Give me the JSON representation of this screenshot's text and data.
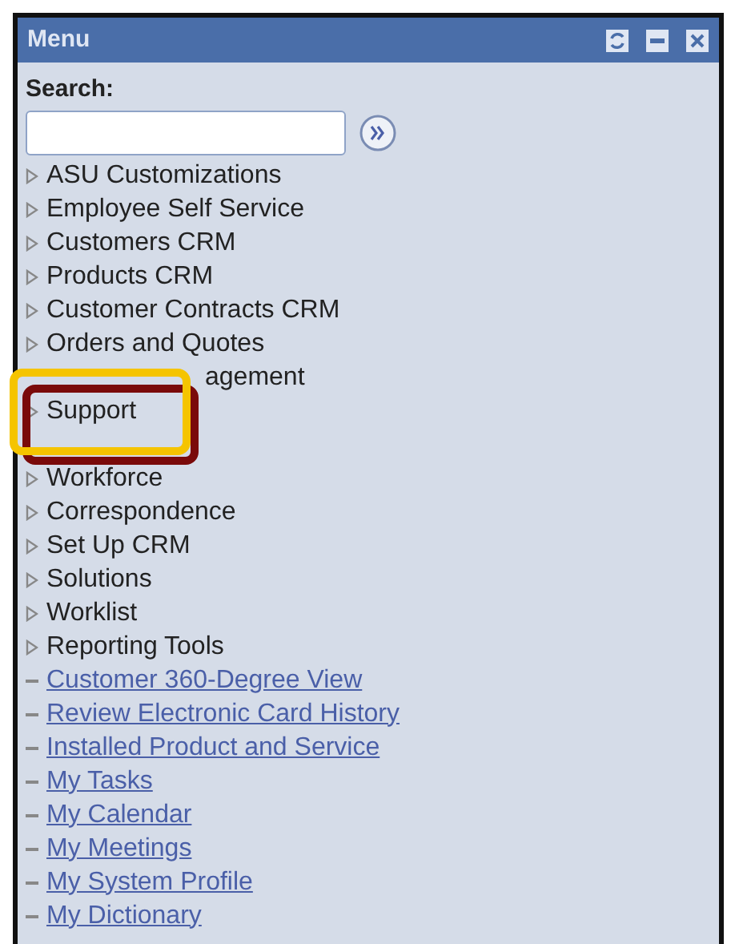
{
  "window": {
    "title": "Menu"
  },
  "search": {
    "label": "Search:"
  },
  "items": [
    {
      "kind": "folder",
      "label": "ASU Customizations"
    },
    {
      "kind": "folder",
      "label": "Employee Self Service"
    },
    {
      "kind": "folder",
      "label": "Customers CRM"
    },
    {
      "kind": "folder",
      "label": "Products CRM"
    },
    {
      "kind": "folder",
      "label": "Customer Contracts CRM"
    },
    {
      "kind": "folder",
      "label": "Orders and Quotes"
    },
    {
      "kind": "partial",
      "label": "agement"
    },
    {
      "kind": "folder",
      "label": "Support"
    },
    {
      "kind": "covered"
    },
    {
      "kind": "folder",
      "label": "Workforce"
    },
    {
      "kind": "folder",
      "label": "Correspondence"
    },
    {
      "kind": "folder",
      "label": "Set Up CRM"
    },
    {
      "kind": "folder",
      "label": "Solutions"
    },
    {
      "kind": "folder",
      "label": "Worklist"
    },
    {
      "kind": "folder",
      "label": "Reporting Tools"
    },
    {
      "kind": "link",
      "label": "Customer 360-Degree View"
    },
    {
      "kind": "link",
      "label": "Review Electronic Card History"
    },
    {
      "kind": "link",
      "label": "Installed Product and Service"
    },
    {
      "kind": "link",
      "label": "My Tasks"
    },
    {
      "kind": "link",
      "label": "My Calendar"
    },
    {
      "kind": "link",
      "label": "My Meetings"
    },
    {
      "kind": "link",
      "label": "My System Profile"
    },
    {
      "kind": "link",
      "label": "My Dictionary"
    }
  ]
}
